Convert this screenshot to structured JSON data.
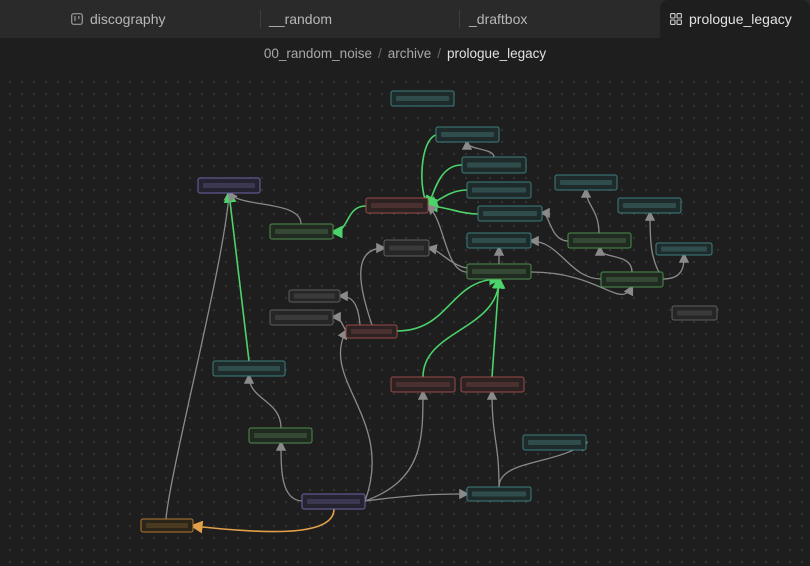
{
  "tabs": [
    {
      "label": "discography",
      "icon": "kanban-board-icon",
      "active": false
    },
    {
      "label": "__random",
      "icon": "",
      "active": false
    },
    {
      "label": "_draftbox",
      "icon": "",
      "active": false
    },
    {
      "label": "prologue_legacy",
      "icon": "canvas-grid-icon",
      "active": true
    }
  ],
  "breadcrumb": {
    "root": "00_random_noise",
    "folder": "archive",
    "current": "prologue_legacy",
    "separator": "/"
  },
  "colors": {
    "purple": "#8c7cc8",
    "red": "#c85a5a",
    "green": "#5aa85a",
    "cyan": "#4aa0a0",
    "gray": "#707070",
    "orange": "#d08a3a",
    "edge_gray": "#8a8a8a",
    "edge_green": "#4cd36a",
    "edge_orange": "#e0a048"
  },
  "graph": {
    "nodes": [
      {
        "id": "n1",
        "color": "cyan"
      },
      {
        "id": "n2",
        "color": "cyan"
      },
      {
        "id": "n3",
        "color": "cyan"
      },
      {
        "id": "n4",
        "color": "cyan"
      },
      {
        "id": "n5",
        "color": "cyan"
      },
      {
        "id": "n6",
        "color": "purple"
      },
      {
        "id": "n7",
        "color": "red"
      },
      {
        "id": "n8",
        "color": "green"
      },
      {
        "id": "n9",
        "color": "cyan"
      },
      {
        "id": "n10",
        "color": "gray"
      },
      {
        "id": "n11",
        "color": "cyan"
      },
      {
        "id": "n12",
        "color": "cyan"
      },
      {
        "id": "n13",
        "color": "green"
      },
      {
        "id": "n14",
        "color": "green"
      },
      {
        "id": "n15",
        "color": "cyan"
      },
      {
        "id": "n16",
        "color": "green"
      },
      {
        "id": "n17",
        "color": "gray"
      },
      {
        "id": "n18",
        "color": "gray"
      },
      {
        "id": "n19",
        "color": "gray"
      },
      {
        "id": "n20",
        "color": "red"
      },
      {
        "id": "n21",
        "color": "cyan"
      },
      {
        "id": "n22",
        "color": "red"
      },
      {
        "id": "n23",
        "color": "red"
      },
      {
        "id": "n24",
        "color": "green"
      },
      {
        "id": "n25",
        "color": "cyan"
      },
      {
        "id": "n26",
        "color": "purple"
      },
      {
        "id": "n27",
        "color": "cyan"
      },
      {
        "id": "n28",
        "color": "orange"
      }
    ],
    "edges": [
      {
        "from": "n26",
        "to": "n28",
        "color": "edge_orange"
      },
      {
        "from": "n28",
        "to": "n6",
        "color": "edge_gray"
      },
      {
        "from": "n21",
        "to": "n6",
        "color": "edge_green"
      },
      {
        "from": "n24",
        "to": "n21",
        "color": "edge_gray"
      },
      {
        "from": "n26",
        "to": "n24",
        "color": "edge_gray"
      },
      {
        "from": "n8",
        "to": "n6",
        "color": "edge_gray"
      },
      {
        "from": "n7",
        "to": "n8",
        "color": "edge_green"
      },
      {
        "from": "n2",
        "to": "n7",
        "color": "edge_green"
      },
      {
        "from": "n3",
        "to": "n7",
        "color": "edge_green"
      },
      {
        "from": "n4",
        "to": "n7",
        "color": "edge_green"
      },
      {
        "from": "n9",
        "to": "n7",
        "color": "edge_green"
      },
      {
        "from": "n3",
        "to": "n2",
        "color": "edge_gray"
      },
      {
        "from": "n14",
        "to": "n9",
        "color": "edge_gray"
      },
      {
        "from": "n14",
        "to": "n5",
        "color": "edge_gray"
      },
      {
        "from": "n16",
        "to": "n14",
        "color": "edge_gray"
      },
      {
        "from": "n16",
        "to": "n11",
        "color": "edge_gray"
      },
      {
        "from": "n16",
        "to": "n15",
        "color": "edge_gray"
      },
      {
        "from": "n16",
        "to": "n25",
        "color": "edge_gray"
      },
      {
        "from": "n13",
        "to": "n16",
        "color": "edge_gray"
      },
      {
        "from": "n13",
        "to": "n12",
        "color": "edge_gray"
      },
      {
        "from": "n13",
        "to": "n7",
        "color": "edge_gray"
      },
      {
        "from": "n13",
        "to": "n10",
        "color": "edge_gray"
      },
      {
        "from": "n20",
        "to": "n10",
        "color": "edge_gray"
      },
      {
        "from": "n20",
        "to": "n17",
        "color": "edge_gray"
      },
      {
        "from": "n20",
        "to": "n18",
        "color": "edge_gray"
      },
      {
        "from": "n20",
        "to": "n13",
        "color": "edge_green"
      },
      {
        "from": "n22",
        "to": "n13",
        "color": "edge_green"
      },
      {
        "from": "n23",
        "to": "n13",
        "color": "edge_green"
      },
      {
        "from": "n26",
        "to": "n20",
        "color": "edge_gray"
      },
      {
        "from": "n26",
        "to": "n22",
        "color": "edge_gray"
      },
      {
        "from": "n26",
        "to": "n27",
        "color": "edge_gray"
      },
      {
        "from": "n27",
        "to": "n23",
        "color": "edge_gray"
      },
      {
        "from": "n27",
        "to": "n19",
        "color": "edge_gray"
      }
    ]
  }
}
